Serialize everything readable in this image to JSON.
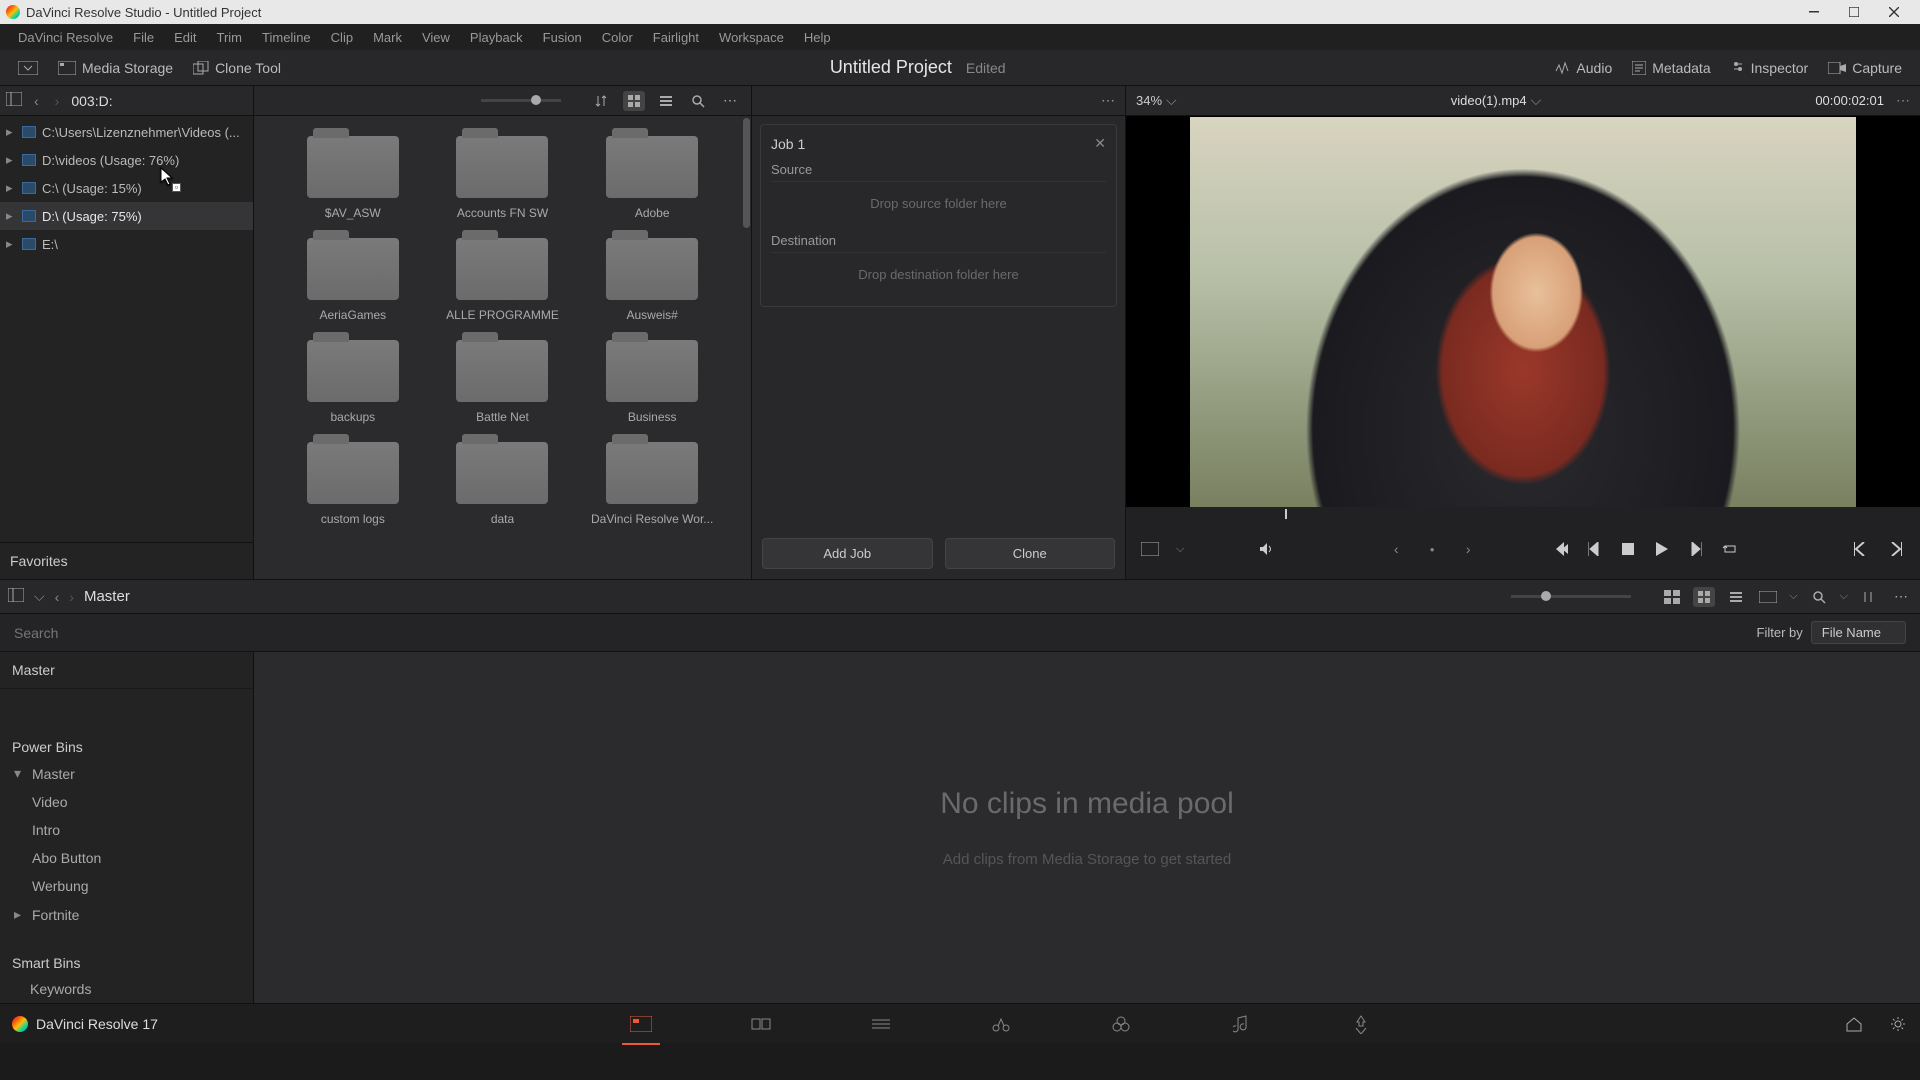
{
  "window": {
    "title": "DaVinci Resolve Studio - Untitled Project"
  },
  "menu": [
    "DaVinci Resolve",
    "File",
    "Edit",
    "Trim",
    "Timeline",
    "Clip",
    "Mark",
    "View",
    "Playback",
    "Fusion",
    "Color",
    "Fairlight",
    "Workspace",
    "Help"
  ],
  "toolbar": {
    "media_storage": "Media Storage",
    "clone_tool": "Clone Tool",
    "project_title": "Untitled Project",
    "edited": "Edited",
    "audio": "Audio",
    "metadata": "Metadata",
    "inspector": "Inspector",
    "capture": "Capture"
  },
  "path": {
    "label": "003:D:"
  },
  "storage_tree": [
    {
      "label": "C:\\Users\\Lizenznehmer\\Videos (...",
      "selected": false,
      "expand": true
    },
    {
      "label": "D:\\videos (Usage: 76%)",
      "selected": false,
      "expand": true
    },
    {
      "label": "C:\\ (Usage: 15%)",
      "selected": false,
      "expand": true
    },
    {
      "label": "D:\\ (Usage: 75%)",
      "selected": true,
      "expand": true
    },
    {
      "label": "E:\\",
      "selected": false,
      "expand": true
    }
  ],
  "favorites": "Favorites",
  "folders": [
    "$AV_ASW",
    "Accounts FN SW",
    "Adobe",
    "AeriaGames",
    "ALLE PROGRAMME",
    "Ausweis#",
    "backups",
    "Battle Net",
    "Business",
    "custom logs",
    "data",
    "DaVinci Resolve Wor..."
  ],
  "clone": {
    "job": "Job 1",
    "source": "Source",
    "source_drop": "Drop source folder here",
    "dest": "Destination",
    "dest_drop": "Drop destination folder here",
    "add_job": "Add Job",
    "clone_btn": "Clone"
  },
  "viewer": {
    "zoom": "34%",
    "filename": "video(1).mp4",
    "timecode": "00:00:02:01"
  },
  "lower": {
    "breadcrumb": "Master",
    "search_ph": "Search",
    "filter_by": "Filter by",
    "filter_sel": "File Name",
    "master": "Master",
    "power_bins": "Power Bins",
    "bins": [
      {
        "label": "Master",
        "chev": "▾"
      },
      {
        "label": "Video"
      },
      {
        "label": "Intro"
      },
      {
        "label": "Abo Button"
      },
      {
        "label": "Werbung"
      },
      {
        "label": "Fortnite",
        "chev": "▸"
      }
    ],
    "smart_bins": "Smart Bins",
    "keywords": "Keywords",
    "empty": "No clips in media pool",
    "hint": "Add clips from Media Storage to get started"
  },
  "bottom": {
    "app": "DaVinci Resolve 17"
  }
}
